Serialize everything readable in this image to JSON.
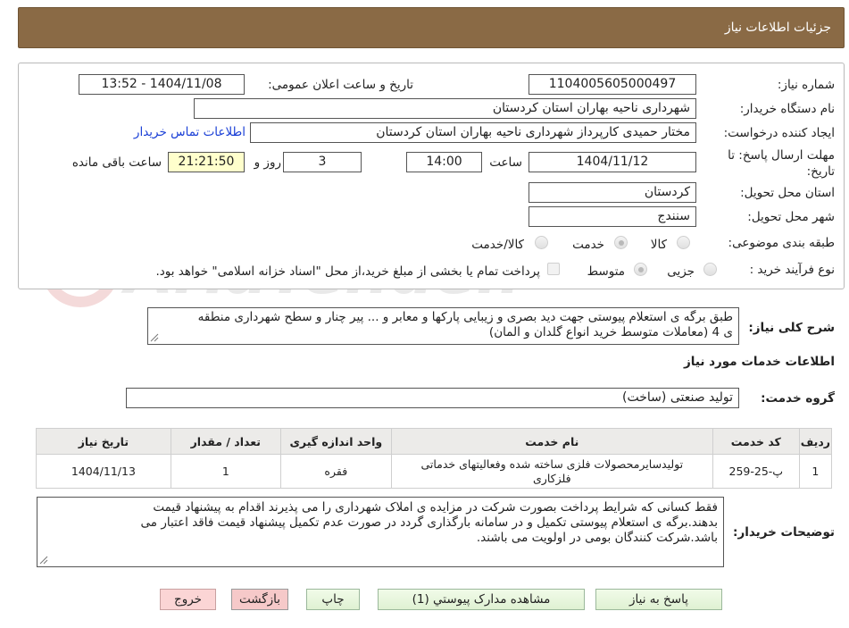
{
  "header": {
    "title": "جزئیات اطلاعات نیاز"
  },
  "form": {
    "need_number": {
      "label": "شماره نیاز:",
      "value": "1104005605000497"
    },
    "announce_datetime": {
      "label": "تاریخ و ساعت اعلان عمومی:",
      "value": "1404/11/08 - 13:52"
    },
    "buyer_org": {
      "label": "نام دستگاه خریدار:",
      "value": "شهرداری ناحیه بهاران استان کردستان"
    },
    "requester": {
      "label": "ایجاد کننده درخواست:",
      "value": "مختار حمیدی کارپرداز شهرداری ناحیه بهاران استان کردستان"
    },
    "contact_link": "اطلاعات تماس خریدار",
    "deadline": {
      "label_line1": "مهلت ارسال پاسخ: تا",
      "label_line2": "تاریخ:",
      "date": "1404/11/12",
      "time_label": "ساعت",
      "time": "14:00",
      "days": "3",
      "days_label": "روز و",
      "remaining": "21:21:50",
      "remaining_label": "ساعت باقی مانده"
    },
    "delivery_province": {
      "label": "استان محل تحویل:",
      "value": "کردستان"
    },
    "delivery_city": {
      "label": "شهر محل تحویل:",
      "value": "سنندج"
    },
    "category": {
      "label": "طبقه بندی موضوعی:",
      "options": [
        "کالا",
        "خدمت",
        "کالا/خدمت"
      ],
      "selected": "خدمت"
    },
    "process": {
      "label": "نوع فرآیند خرید :",
      "options": [
        "جزیی",
        "متوسط"
      ],
      "selected": "متوسط",
      "payment_note": "پرداخت تمام یا بخشی از مبلغ خرید،از محل \"اسناد خزانه اسلامی\" خواهد بود."
    }
  },
  "description": {
    "label": "شرح کلی نیاز:",
    "line1": "طبق برگه ی استعلام پیوستی جهت دید بصری و زیبایی پارکها و معابر و ... پیر چنار و سطح شهرداری منطقه",
    "line2": "ی 4 (معاملات متوسط خرید انواع گلدان و المان)"
  },
  "services_section": {
    "title": "اطلاعات خدمات مورد نیاز"
  },
  "service_group": {
    "label": "گروه خدمت:",
    "value": "تولید صنعتی (ساخت)"
  },
  "table": {
    "headers": [
      "ردیف",
      "کد خدمت",
      "نام خدمت",
      "واحد اندازه گیری",
      "تعداد / مقدار",
      "تاریخ نیاز"
    ],
    "rows": [
      {
        "row": "1",
        "code": "پ-25-259",
        "name_line1": "تولیدسایرمحصولات فلزی ساخته شده وفعالیتهای خدماتی",
        "name_line2": "فلزکاری",
        "unit": "فقره",
        "qty": "1",
        "date": "1404/11/13"
      }
    ]
  },
  "buyer_notes": {
    "label": "توضیحات خریدار:",
    "line1": "فقط کسانی که شرایط پرداخت بصورت شرکت در مزایده ی املاک شهرداری را می پذیرند اقدام به پیشنهاد قیمت",
    "line2": "بدهند.برگه ی استعلام پیوستی تکمیل و در سامانه بارگذاری گردد در صورت عدم تکمیل پیشنهاد قیمت فاقد اعتبار می",
    "line3": "باشد.شرکت کنندگان بومی در اولویت می باشند."
  },
  "buttons": {
    "reply": "پاسخ به نیاز",
    "attachments": "مشاهده مدارک پیوستي (1)",
    "print": "چاپ",
    "back": "بازگشت",
    "exit": "خروج"
  },
  "watermark": {
    "text": "AriaTender.neT"
  },
  "colors": {
    "header_bg": "#8a6a45",
    "link": "#1a3fd6",
    "remaining_bg": "#ffffcc"
  }
}
